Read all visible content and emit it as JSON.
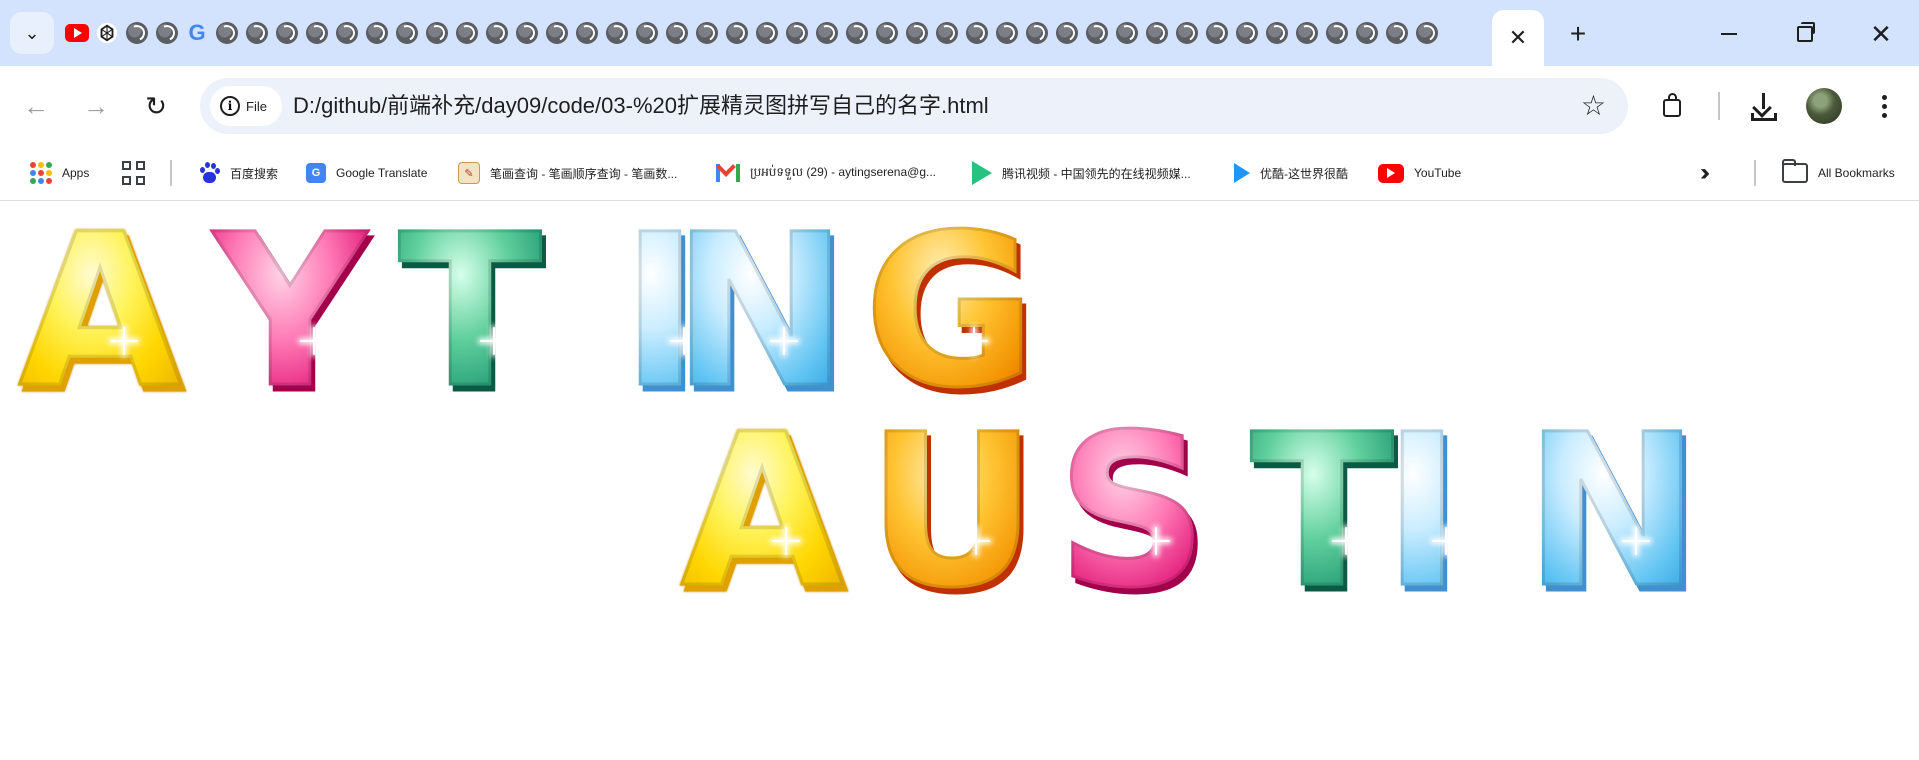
{
  "browser": {
    "tab_count_icons": 46,
    "active_tab_close": "✕",
    "new_tab": "+",
    "window": {
      "minimize": "minimize",
      "restore": "restore",
      "close": "✕"
    }
  },
  "toolbar": {
    "site_chip_label": "File",
    "url": "D:/github/前端补充/day09/code/03-%20扩展精灵图拼写自己的名字.html"
  },
  "bookmarks": {
    "apps_label": "Apps",
    "items": [
      {
        "label": "百度搜索",
        "icon": "baidu-icon"
      },
      {
        "label": "Google Translate",
        "icon": "google-translate-icon"
      },
      {
        "label": "笔画查询 - 笔画顺序查询 - 笔画数...",
        "icon": "stroke-query-icon"
      },
      {
        "label": "ប្រអប់ទទួល (29) - aytingserena@g...",
        "icon": "gmail-icon"
      },
      {
        "label": "腾讯视频 - 中国领先的在线视频媒...",
        "icon": "tencent-video-icon"
      },
      {
        "label": "优酷-这世界很酷",
        "icon": "youku-icon"
      },
      {
        "label": "YouTube",
        "icon": "youtube-icon"
      }
    ],
    "all_bookmarks": "All Bookmarks"
  },
  "page": {
    "line1": [
      {
        "char": "A",
        "color": "yellow"
      },
      {
        "char": "Y",
        "color": "pink"
      },
      {
        "char": "T",
        "color": "green"
      },
      {
        "char": "I",
        "color": "blue"
      },
      {
        "char": "N",
        "color": "blue"
      },
      {
        "char": "G",
        "color": "orange"
      }
    ],
    "line2": [
      {
        "char": "A",
        "color": "yellow"
      },
      {
        "char": "U",
        "color": "orange"
      },
      {
        "char": "S",
        "color": "pink"
      },
      {
        "char": "T",
        "color": "green"
      },
      {
        "char": "I",
        "color": "blue"
      },
      {
        "char": "N",
        "color": "blue"
      }
    ]
  }
}
